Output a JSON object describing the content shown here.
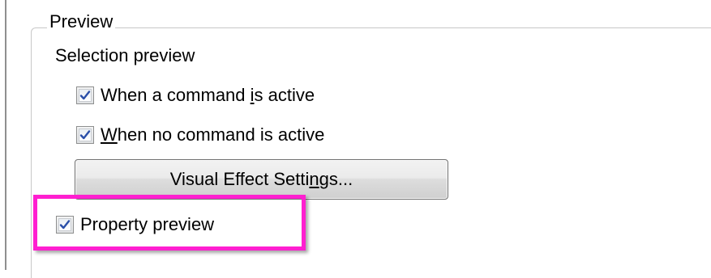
{
  "group": {
    "legend": "Preview"
  },
  "selection": {
    "label": "Selection preview",
    "options": [
      {
        "pre": "When a command ",
        "ul": "i",
        "post": "s active",
        "checked": true
      },
      {
        "pre": "",
        "ul": "W",
        "post": "hen no command is active",
        "checked": true
      }
    ]
  },
  "button": {
    "pre": "Visual Effect Setti",
    "ul": "n",
    "post": "gs..."
  },
  "property": {
    "label": "Property preview",
    "checked": true
  },
  "colors": {
    "highlight": "#ff1fd0",
    "checkmark": "#2a4fa8"
  }
}
